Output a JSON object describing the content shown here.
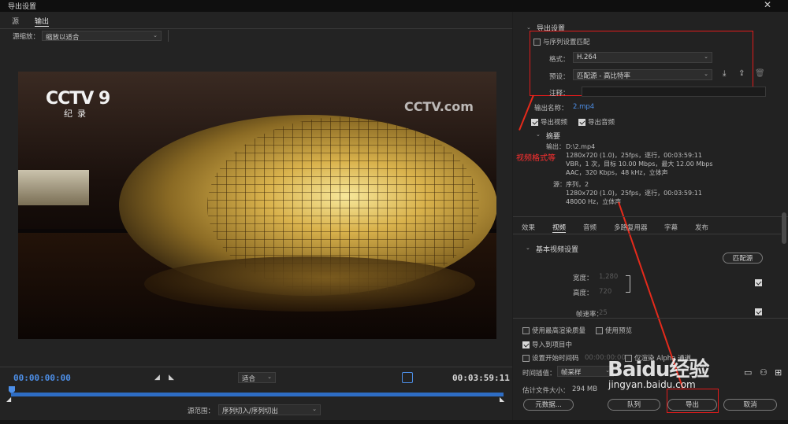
{
  "window": {
    "title": "导出设置",
    "close": "✕"
  },
  "left": {
    "tabs": [
      "源",
      "输出"
    ],
    "scale_label": "源缩放：",
    "scale_value": "缩放以适合",
    "time_start": "00:00:00:00",
    "time_end": "00:03:59:11",
    "fit_value": "适合",
    "range_label": "源范围：",
    "range_value": "序列切入/序列切出",
    "video_text": {
      "logo_left": "CCTV 9",
      "logo_left_sub": "纪录",
      "logo_right": "CCTV.com"
    }
  },
  "export": {
    "header": "导出设置",
    "match_sequence": "与序列设置匹配",
    "format_label": "格式：",
    "format_value": "H.264",
    "preset_label": "预设：",
    "preset_value": "匹配源 - 高比特率",
    "comment_label": "注释：",
    "output_name_label": "输出名称：",
    "output_name_value": "2.mp4",
    "export_video": "导出视频",
    "export_audio": "导出音频",
    "summary_header": "摘要",
    "output_label": "输出：",
    "output_lines": [
      "D:\\2.mp4",
      "1280x720 (1.0)，25fps，逐行，00:03:59:11",
      "VBR，1 次，目标 10.00 Mbps，最大 12.00 Mbps",
      "AAC，320 Kbps，48 kHz，立体声"
    ],
    "source_label": "源：",
    "source_lines": [
      "序列，2",
      "1280x720 (1.0)，25fps，逐行，00:03:59:11",
      "48000 Hz，立体声"
    ],
    "annotation": "视频格式等"
  },
  "tabs": [
    "效果",
    "视频",
    "音频",
    "多路复用器",
    "字幕",
    "发布"
  ],
  "video_settings": {
    "header": "基本视频设置",
    "match_source": "匹配源",
    "width_label": "宽度：",
    "width_value": "1,280",
    "height_label": "高度：",
    "height_value": "720",
    "framerate_label": "帧速率：",
    "framerate_value": "25"
  },
  "bottom": {
    "max_render": "使用最高渲染质量",
    "use_preview": "使用预览",
    "import_project": "导入到项目中",
    "set_start_tc": "设置开始时间码",
    "start_tc_value": "00:00:00:00",
    "alpha_only": "仅渲染 Alpha 通道",
    "interp_label": "时间插值：",
    "interp_value": "帧采样",
    "filesize_label": "估计文件大小：",
    "filesize_value": "294 MB",
    "metadata_btn": "元数据...",
    "queue_btn": "队列",
    "export_btn": "导出",
    "cancel_btn": "取消"
  },
  "watermark": {
    "brand": "Baidu经验",
    "url": "jingyan.baidu.com"
  },
  "colors": {
    "accent": "#4d8fe8",
    "annotation": "#e21b1b"
  }
}
